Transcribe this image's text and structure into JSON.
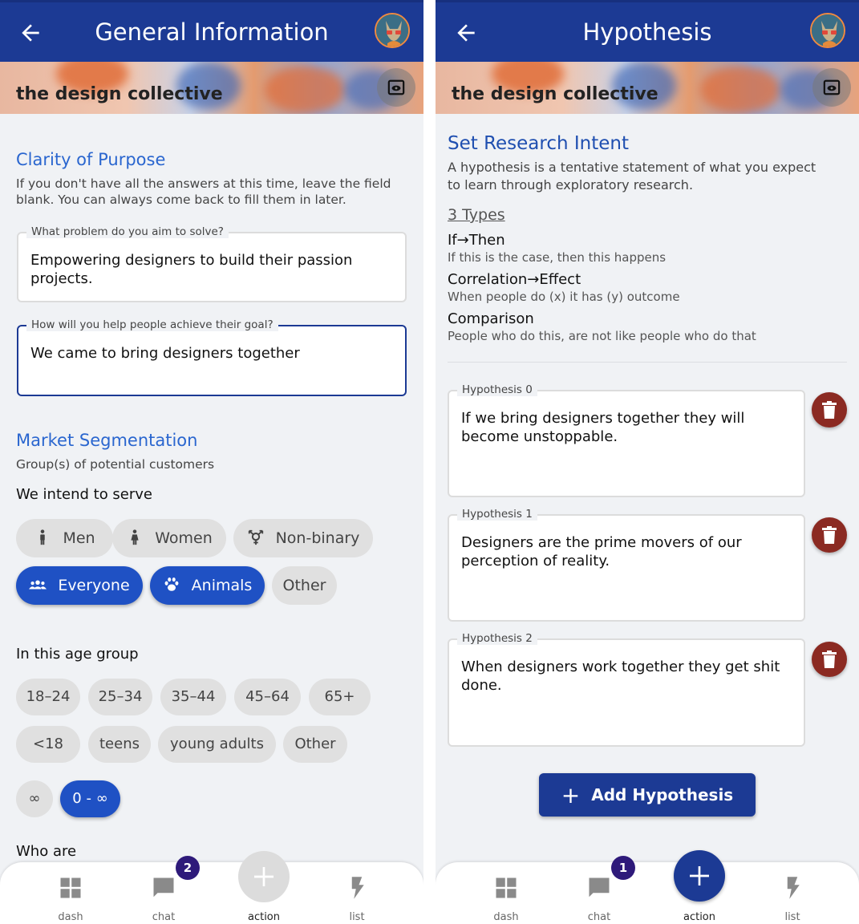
{
  "colors": {
    "primary": "#1c3a94",
    "accent": "#2a66cf",
    "chip_on": "#1f51c4",
    "trash": "#8b2a22",
    "badge": "#2e1a7a"
  },
  "left": {
    "header": {
      "title": "General Information",
      "back_icon": "arrow-left-icon",
      "avatar_icon": "avatar"
    },
    "banner": {
      "org_name": "the design collective",
      "preview_icon": "eye-icon"
    },
    "clarity": {
      "title": "Clarity of Purpose",
      "desc_line1": "If you don't have all the answers at this time, leave the field",
      "desc_line2": "blank. You can always come back to fill them in later.",
      "q1_label": "What problem do you aim to solve?",
      "q1_value_line1": "Empowering designers to build their passion",
      "q1_value_line2": "projects.",
      "q2_label": "How will you help people achieve their goal?",
      "q2_value": "We came to bring designers together"
    },
    "market": {
      "title": "Market Segmentation",
      "desc": "Group(s) of potential customers",
      "serve_label": "We intend to serve",
      "serve_chips": [
        "Men",
        "Women",
        "Non-binary",
        "Everyone",
        "Animals",
        "Other"
      ],
      "serve_selected": [
        "Everyone",
        "Animals"
      ],
      "age_label": "In this age group",
      "age_chips": [
        "18–24",
        "25–34",
        "35–44",
        "45–64",
        "65+",
        "<18",
        "teens",
        "young adults",
        "Other",
        "∞",
        "0 - ∞"
      ],
      "age_selected": [
        "0 - ∞"
      ],
      "who_label": "Who are"
    },
    "nav": {
      "items": [
        {
          "label": "dash",
          "icon": "dashboard-icon"
        },
        {
          "label": "chat",
          "icon": "chat-icon",
          "badge": "2"
        },
        {
          "label": "action",
          "icon": "plus-icon"
        },
        {
          "label": "list",
          "icon": "bolt-icon"
        }
      ]
    }
  },
  "right": {
    "header": {
      "title": "Hypothesis",
      "back_icon": "arrow-left-icon",
      "avatar_icon": "avatar"
    },
    "banner": {
      "org_name": "the design collective",
      "preview_icon": "eye-icon"
    },
    "intent": {
      "title": "Set Research Intent",
      "desc_line1": "A hypothesis is a tentative statement of what you expect",
      "desc_line2": "to learn through exploratory research.",
      "types_heading": "3 Types",
      "types": [
        {
          "name": "If→Then",
          "desc": "If this is the case, then this happens"
        },
        {
          "name": "Correlation→Effect",
          "desc": "When people do (x) it has (y) outcome"
        },
        {
          "name": "Comparison",
          "desc": "People who do this, are not like people who do that"
        }
      ]
    },
    "hypotheses": [
      {
        "label": "Hypothesis 0",
        "line1": "If we bring designers together they will",
        "line2": "become unstoppable."
      },
      {
        "label": "Hypothesis 1",
        "line1": "Designers are the prime movers of our",
        "line2": "perception of reality."
      },
      {
        "label": "Hypothesis 2",
        "line1": "When designers work together they get shit",
        "line2": "done."
      }
    ],
    "add_button": "Add Hypothesis",
    "nav": {
      "items": [
        {
          "label": "dash",
          "icon": "dashboard-icon"
        },
        {
          "label": "chat",
          "icon": "chat-icon",
          "badge": "1"
        },
        {
          "label": "action",
          "icon": "plus-icon"
        },
        {
          "label": "list",
          "icon": "bolt-icon"
        }
      ]
    }
  }
}
